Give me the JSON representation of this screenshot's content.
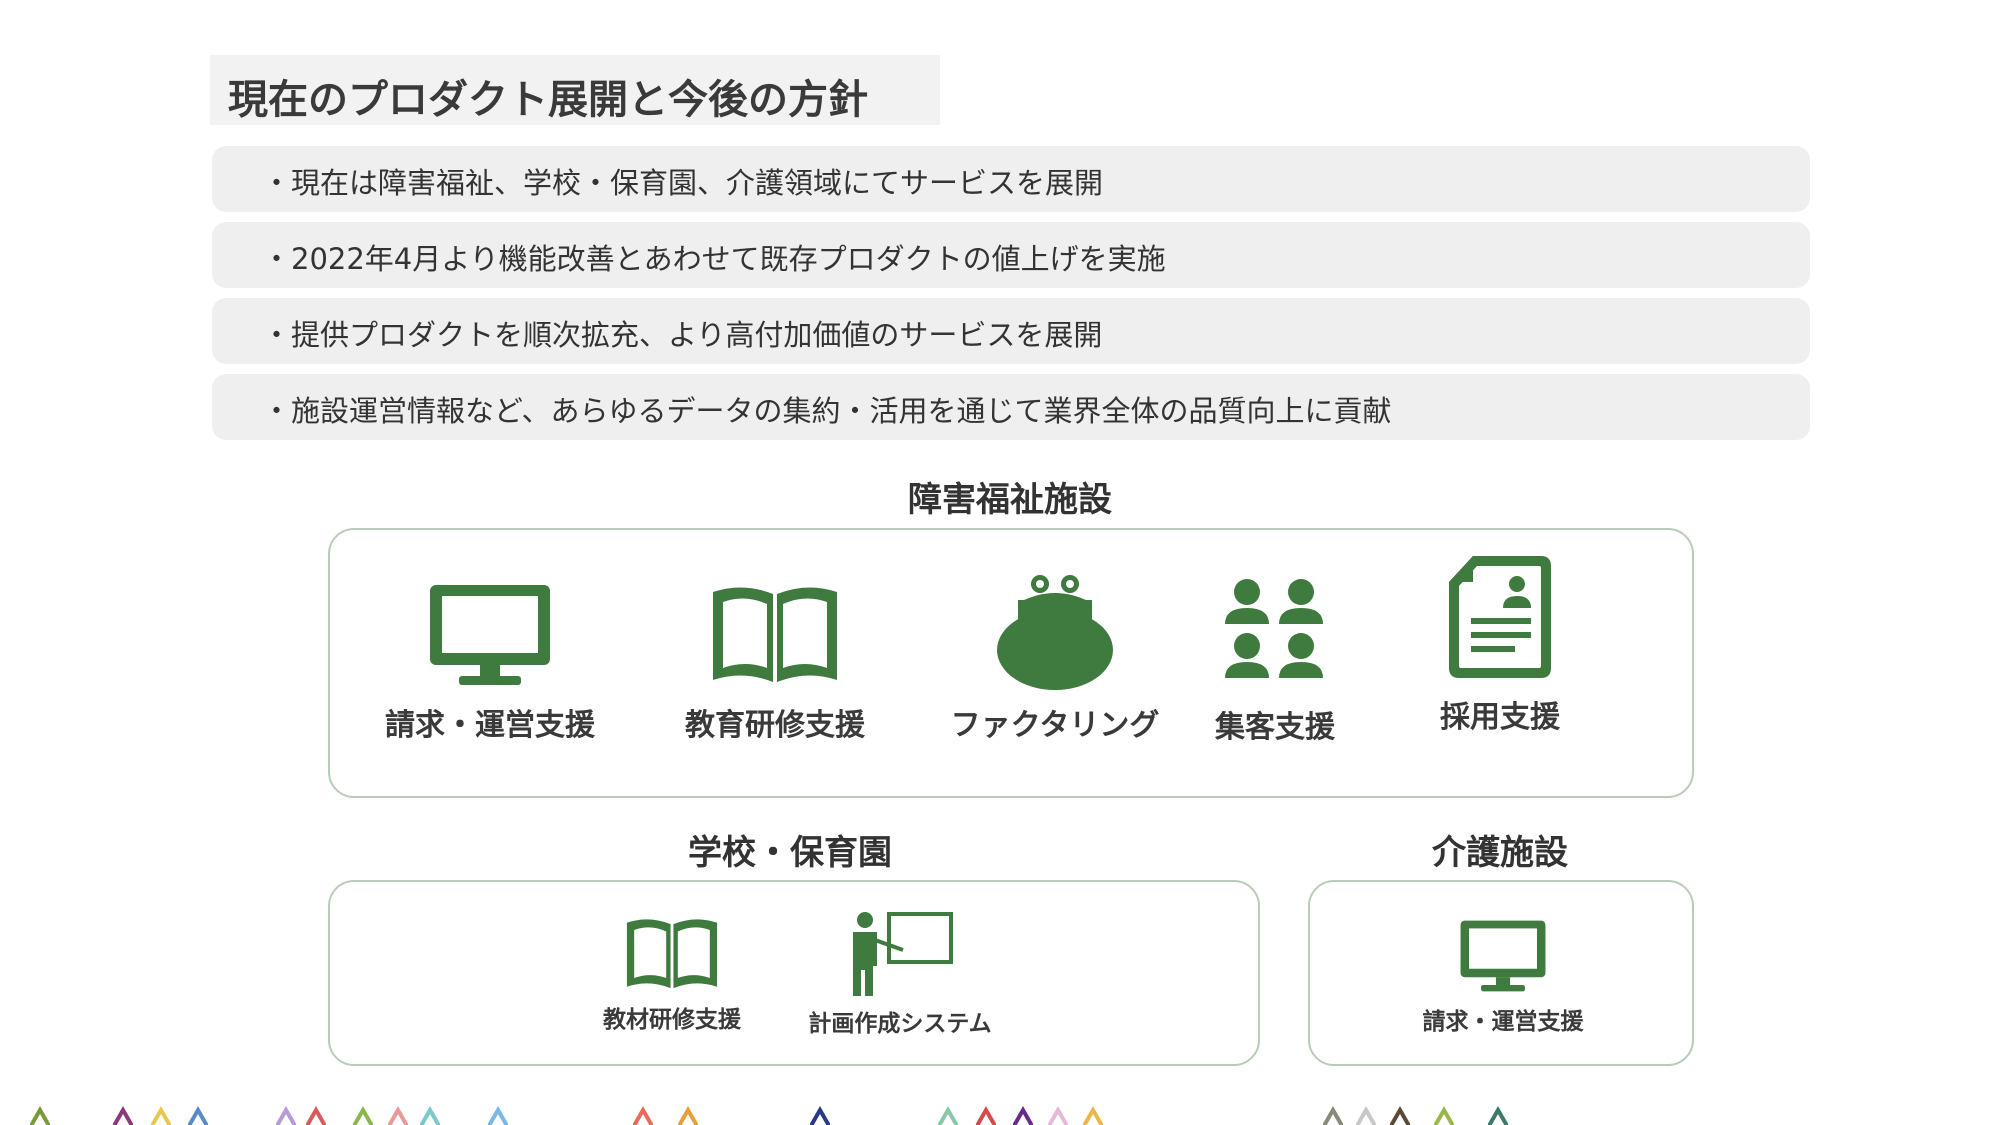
{
  "title": "現在のプロダクト展開と今後の方針",
  "bullets": [
    "・現在は障害福祉、学校・保育園、介護領域にてサービスを展開",
    "・2022年4月より機能改善とあわせて既存プロダクトの値上げを実施",
    "・提供プロダクトを順次拡充、より高付加価値のサービスを展開",
    "・施設運営情報など、あらゆるデータの集約・活用を通じて業界全体の品質向上に貢献"
  ],
  "sections": {
    "welfare": {
      "title": "障害福祉施設",
      "services": [
        {
          "label": "請求・運営支援",
          "icon": "monitor-icon"
        },
        {
          "label": "教育研修支援",
          "icon": "book-icon"
        },
        {
          "label": "ファクタリング",
          "icon": "purse-icon"
        },
        {
          "label": "集客支援",
          "icon": "people-icon"
        },
        {
          "label": "採用支援",
          "icon": "resume-icon"
        }
      ]
    },
    "school": {
      "title": "学校・保育園",
      "services": [
        {
          "label": "教材研修支援",
          "icon": "book-icon"
        },
        {
          "label": "計画作成システム",
          "icon": "teacher-icon"
        }
      ]
    },
    "care": {
      "title": "介護施設",
      "services": [
        {
          "label": "請求・運営支援",
          "icon": "monitor-icon"
        }
      ]
    }
  },
  "colors": {
    "icon_green": "#3f7a3f",
    "panel_border": "#b8cdb8",
    "bullet_bg": "#efefef",
    "title_bg": "#f2f2f2"
  }
}
